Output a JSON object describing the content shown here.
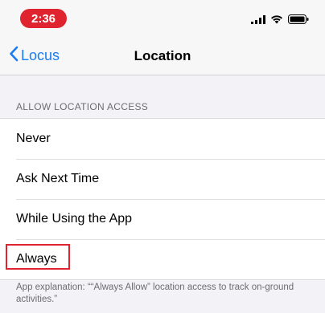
{
  "status_bar": {
    "time": "2:36",
    "icons": [
      "signal-icon",
      "wifi-icon",
      "battery-icon"
    ]
  },
  "nav": {
    "back_label": "Locus",
    "title": "Location"
  },
  "section": {
    "header": "ALLOW LOCATION ACCESS"
  },
  "options": [
    {
      "label": "Never"
    },
    {
      "label": "Ask Next Time"
    },
    {
      "label": "While Using the App"
    },
    {
      "label": "Always",
      "highlighted": true
    }
  ],
  "footer": {
    "explanation": "App explanation: ““Always Allow” location access to track on-ground activities.”"
  },
  "colors": {
    "accent": "#1a7cf0",
    "highlight": "#e0242f"
  }
}
